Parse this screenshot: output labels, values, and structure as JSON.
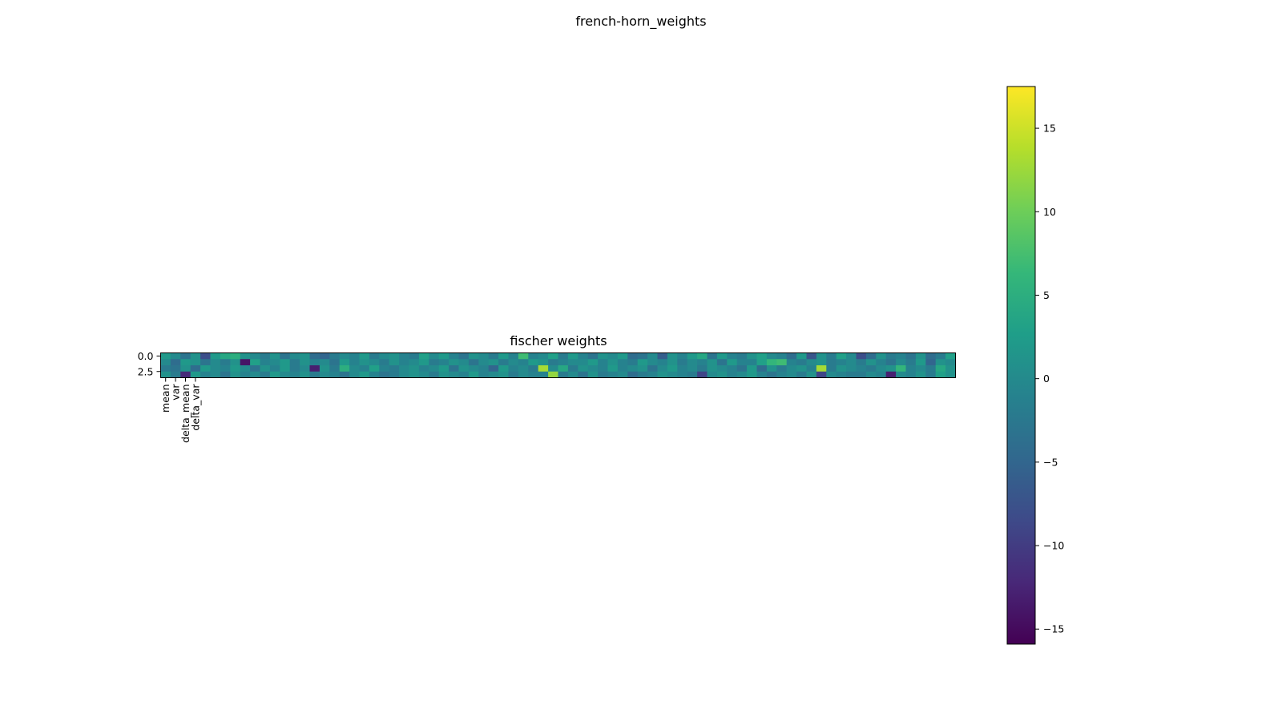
{
  "figure": {
    "title": "french-horn_weights"
  },
  "chart_data": {
    "type": "heatmap",
    "title": "fischer weights",
    "n_rows": 4,
    "n_cols": 80,
    "y_ticks": [
      {
        "value": 0.0,
        "label": "0.0"
      },
      {
        "value": 2.5,
        "label": "2.5"
      }
    ],
    "x_ticks": [
      {
        "value": 0,
        "label": "mean"
      },
      {
        "value": 1,
        "label": "var"
      },
      {
        "value": 2,
        "label": "delta_mean"
      },
      {
        "value": 3,
        "label": "delta_var"
      }
    ],
    "colormap": "viridis",
    "colorbar": {
      "vmin": -15.9,
      "vmax": 17.5,
      "ticks": [
        {
          "value": -15,
          "label": "−15"
        },
        {
          "value": -10,
          "label": "−10"
        },
        {
          "value": -5,
          "label": "−5"
        },
        {
          "value": 0,
          "label": "0"
        },
        {
          "value": 5,
          "label": "5"
        },
        {
          "value": 10,
          "label": "10"
        },
        {
          "value": 15,
          "label": "15"
        }
      ]
    },
    "grid": false,
    "values": [
      [
        2,
        0,
        -3,
        1,
        -8,
        2,
        4,
        5,
        1,
        0,
        -2,
        1,
        -3,
        0,
        1,
        -4,
        -5,
        -2,
        0,
        -1,
        2,
        -2,
        0,
        1,
        -1,
        -2,
        3,
        0,
        2,
        -1,
        -3,
        1,
        0,
        -2,
        2,
        -1,
        7,
        -1,
        0,
        3,
        -2,
        2,
        -1,
        -3,
        1,
        0,
        2,
        -4,
        -3,
        0,
        -6,
        1,
        -1,
        2,
        4,
        -3,
        2,
        -1,
        -2,
        1,
        3,
        0,
        -1,
        -4,
        2,
        -7,
        1,
        -2,
        3,
        0,
        -8,
        -4,
        1,
        -2,
        -1,
        -3,
        1,
        -4,
        -2,
        3
      ],
      [
        0,
        -4,
        2,
        1,
        -3,
        0,
        -2,
        1,
        -14,
        3,
        -1,
        0,
        2,
        -2,
        1,
        -1,
        0,
        -3,
        2,
        -1,
        1,
        0,
        -2,
        1,
        -1,
        0,
        2,
        -2,
        -1,
        1,
        0,
        -3,
        0,
        1,
        -2,
        0,
        -1,
        2,
        1,
        -2,
        -1,
        0,
        0,
        2,
        -1,
        1,
        -1,
        -2,
        2,
        0,
        -1,
        1,
        -2,
        0,
        -1,
        1,
        -3,
        2,
        -1,
        -1,
        3,
        6,
        7,
        -1,
        -2,
        0,
        1,
        -2,
        -1,
        0,
        -2,
        1,
        -1,
        -3,
        0,
        -2,
        2,
        -5,
        1,
        0
      ],
      [
        -2,
        -3,
        1,
        -4,
        2,
        0,
        -1,
        2,
        0,
        -3,
        1,
        -1,
        2,
        -2,
        0,
        -13,
        1,
        -2,
        5,
        0,
        -1,
        3,
        -1,
        -2,
        0,
        1,
        -1,
        0,
        2,
        -3,
        1,
        0,
        -1,
        -5,
        2,
        -1,
        0,
        -2,
        13,
        0,
        4,
        -2,
        1,
        0,
        -1,
        2,
        -1,
        0,
        1,
        -3,
        0,
        2,
        -1,
        0,
        -2,
        1,
        0,
        -1,
        -3,
        2,
        -4,
        1,
        -2,
        0,
        1,
        -1,
        13,
        -2,
        1,
        0,
        -1,
        -2,
        0,
        1,
        6,
        -1,
        0,
        -2,
        4,
        1
      ],
      [
        1,
        -2,
        -12,
        2,
        -1,
        0,
        -3,
        1,
        -1,
        0,
        -2,
        2,
        0,
        -1,
        1,
        -2,
        0,
        -1,
        -3,
        0,
        2,
        -1,
        -3,
        -2,
        0,
        1,
        0,
        -2,
        1,
        0,
        -1,
        2,
        -1,
        0,
        1,
        -2,
        0,
        -1,
        -1,
        12,
        -2,
        0,
        -3,
        1,
        -2,
        -1,
        0,
        -4,
        -2,
        -1,
        1,
        0,
        -1,
        -2,
        -9,
        0,
        1,
        -1,
        0,
        2,
        -1,
        -3,
        -1,
        0,
        -2,
        1,
        -9,
        0,
        -1,
        -2,
        -2,
        0,
        -1,
        -13,
        0,
        -1,
        1,
        -2,
        3,
        1
      ]
    ]
  }
}
